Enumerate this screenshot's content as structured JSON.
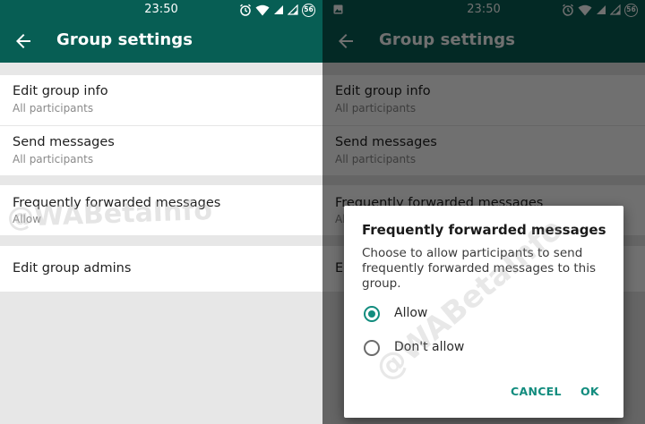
{
  "status": {
    "time": "23:50",
    "battery": "56"
  },
  "toolbar": {
    "title": "Group settings"
  },
  "settings": [
    {
      "title": "Edit group info",
      "subtitle": "All participants"
    },
    {
      "title": "Send messages",
      "subtitle": "All participants"
    },
    {
      "title": "Frequently forwarded messages",
      "subtitle": "Allow"
    },
    {
      "title": "Edit group admins"
    }
  ],
  "dialog": {
    "title": "Frequently forwarded messages",
    "body": "Choose to allow participants to send frequently forwarded messages to this group.",
    "options": [
      {
        "label": "Allow",
        "selected": true
      },
      {
        "label": "Don't allow",
        "selected": false
      }
    ],
    "cancel": "CANCEL",
    "ok": "OK"
  },
  "watermark": "@WABetaInfo",
  "colors": {
    "primary": "#075e54",
    "accent": "#128c7e",
    "background": "#e7e7e7"
  }
}
